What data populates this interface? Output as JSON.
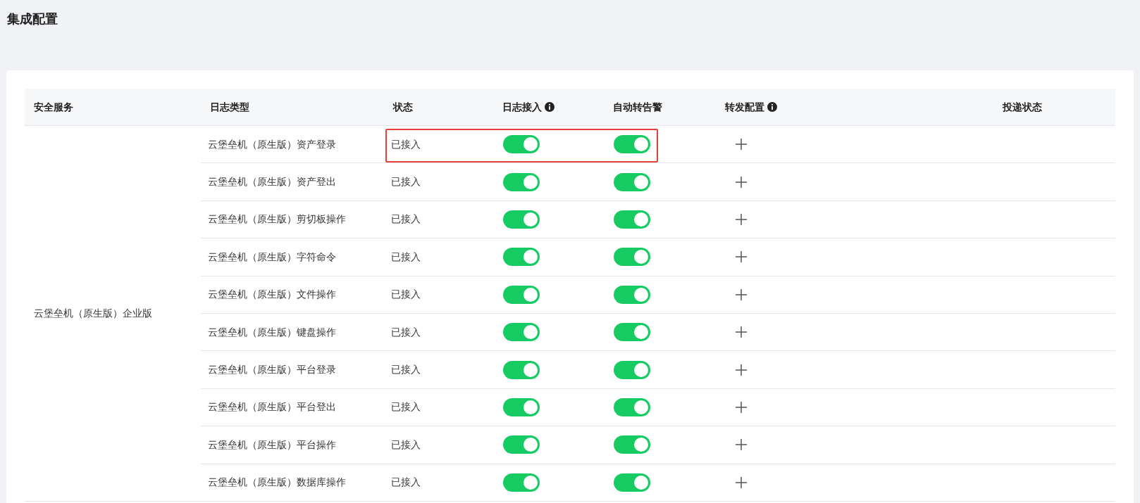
{
  "page_title": "集成配置",
  "columns": [
    {
      "label": "安全服务",
      "kind": "plain"
    },
    {
      "label": "日志类型",
      "kind": "plain"
    },
    {
      "label": "状态",
      "kind": "plain"
    },
    {
      "label": "日志接入",
      "kind": "info"
    },
    {
      "label": "自动转告警",
      "kind": "plain"
    },
    {
      "label": "转发配置",
      "kind": "info"
    },
    {
      "label": "投递状态",
      "kind": "plain"
    }
  ],
  "service": "云堡垒机（原生版）企业版",
  "rows": [
    {
      "log_type": "云堡垒机（原生版）资产登录",
      "status": "已接入",
      "log_access": true,
      "auto_alert": true,
      "highlighted": true
    },
    {
      "log_type": "云堡垒机（原生版）资产登出",
      "status": "已接入",
      "log_access": true,
      "auto_alert": true,
      "highlighted": false
    },
    {
      "log_type": "云堡垒机（原生版）剪切板操作",
      "status": "已接入",
      "log_access": true,
      "auto_alert": true,
      "highlighted": false
    },
    {
      "log_type": "云堡垒机（原生版）字符命令",
      "status": "已接入",
      "log_access": true,
      "auto_alert": true,
      "highlighted": false
    },
    {
      "log_type": "云堡垒机（原生版）文件操作",
      "status": "已接入",
      "log_access": true,
      "auto_alert": true,
      "highlighted": false
    },
    {
      "log_type": "云堡垒机（原生版）键盘操作",
      "status": "已接入",
      "log_access": true,
      "auto_alert": true,
      "highlighted": false
    },
    {
      "log_type": "云堡垒机（原生版）平台登录",
      "status": "已接入",
      "log_access": true,
      "auto_alert": true,
      "highlighted": false
    },
    {
      "log_type": "云堡垒机（原生版）平台登出",
      "status": "已接入",
      "log_access": true,
      "auto_alert": true,
      "highlighted": false
    },
    {
      "log_type": "云堡垒机（原生版）平台操作",
      "status": "已接入",
      "log_access": true,
      "auto_alert": true,
      "highlighted": false
    },
    {
      "log_type": "云堡垒机（原生版）数据库操作",
      "status": "已接入",
      "log_access": true,
      "auto_alert": true,
      "highlighted": false
    }
  ]
}
